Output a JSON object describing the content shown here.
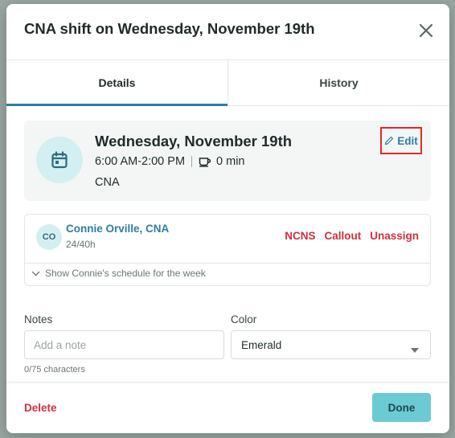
{
  "modal": {
    "title": "CNA shift on Wednesday, November 19th"
  },
  "tabs": [
    {
      "label": "Details",
      "active": true
    },
    {
      "label": "History",
      "active": false
    }
  ],
  "shift": {
    "date": "Wednesday, November 19th",
    "time": "6:00 AM-2:00 PM",
    "break": "0 min",
    "role": "CNA",
    "edit_label": "Edit",
    "icon": "calendar-icon"
  },
  "staff": {
    "initials": "CO",
    "name": "Connie Orville, CNA",
    "hours": "24/40h",
    "actions": [
      "NCNS",
      "Callout",
      "Unassign"
    ],
    "show_schedule_label": "Show Connie's schedule for the week"
  },
  "notes": {
    "label": "Notes",
    "placeholder": "Add a note",
    "value": "",
    "char_count": "0/75 characters"
  },
  "color": {
    "label": "Color",
    "selected": "Emerald"
  },
  "footer": {
    "delete_label": "Delete",
    "done_label": "Done"
  },
  "colors": {
    "accent": "#2e7ea0",
    "danger": "#d12f3d",
    "done_button": "#6ccad3",
    "highlight_border": "#e02a2a",
    "icon_circle": "#d4eff2"
  }
}
